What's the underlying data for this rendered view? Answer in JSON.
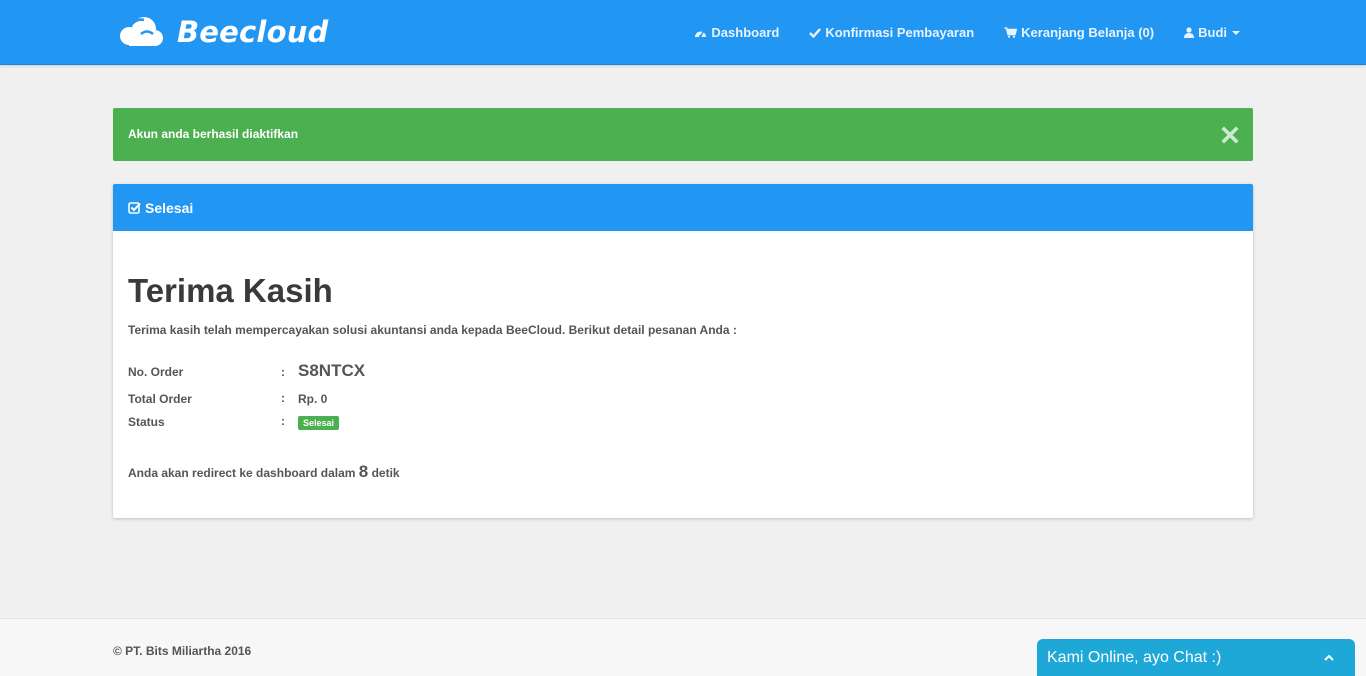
{
  "brand": {
    "name": "Beecloud"
  },
  "nav": {
    "dashboard": "Dashboard",
    "payment_confirmation": "Konfirmasi Pembayaran",
    "cart": "Keranjang Belanja (0)",
    "user": "Budi"
  },
  "alert": {
    "message": "Akun anda berhasil diaktifkan"
  },
  "panel": {
    "heading": "Selesai",
    "title": "Terima Kasih",
    "lead": "Terima kasih telah mempercayakan solusi akuntansi anda kepada BeeCloud. Berikut detail pesanan Anda :",
    "details": {
      "order_no_label": "No. Order",
      "order_no_value": "S8NTCX",
      "total_label": "Total Order",
      "total_value": "Rp. 0",
      "status_label": "Status",
      "status_value": "Selesai",
      "colon": ":"
    },
    "redirect": {
      "before": "Anda akan redirect ke dashboard dalam",
      "count": "8",
      "after": "detik"
    }
  },
  "footer": {
    "text": "© PT. Bits Miliartha 2016"
  },
  "chat": {
    "label": "Kami Online, ayo Chat :)"
  },
  "colors": {
    "primary": "#2196f3",
    "success": "#4caf50",
    "chat": "#1ea8d8",
    "background": "#f0f0f0"
  }
}
